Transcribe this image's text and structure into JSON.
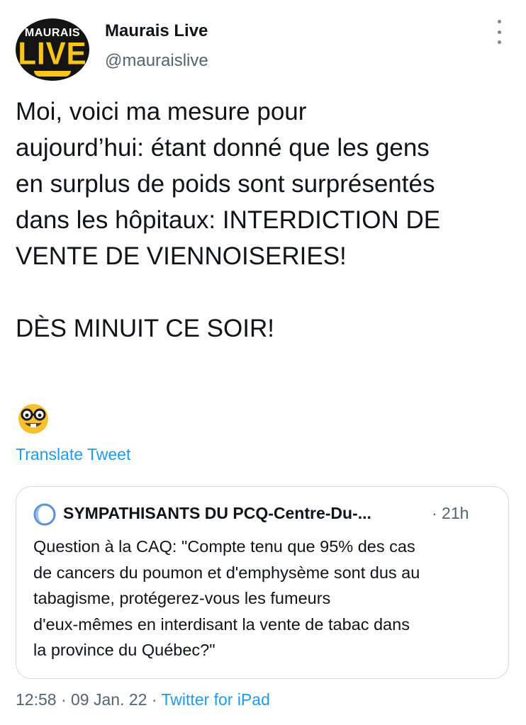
{
  "author": {
    "avatar_logo_top": "MAURAIS",
    "avatar_logo_main": "LIVE",
    "display_name": "Maurais Live",
    "handle": "@mauraislive"
  },
  "tweet": {
    "text": "Moi, voici ma mesure pour\naujourd’hui: étant donné que les gens\nen surplus de poids sont surprésentés\ndans les hôpitaux: INTERDICTION DE\nVENTE DE VIENNOISERIES!\n\nDÈS MINUIT CE SOIR!",
    "emoji": "nerd-face"
  },
  "translate_label": "Translate Tweet",
  "quoted_tweet": {
    "author_name": "SYMPATHISANTS DU PCQ-Centre-Du-...",
    "time": "· 21h",
    "text": "Question à la CAQ: \"Compte tenu que 95% des cas\nde cancers du poumon et d'emphysème sont dus au\ntabagisme, protégerez-vous les fumeurs\nd'eux-mêmes en interdisant la vente de tabac dans\nla province du Québec?\""
  },
  "meta": {
    "time": "12:58",
    "sep1": " · ",
    "date": "09 Jan. 22",
    "sep2": " · ",
    "source": "Twitter for iPad"
  },
  "colors": {
    "link": "#1d9bf0",
    "secondary_text": "#536471",
    "logo_yellow": "#f5c518"
  }
}
